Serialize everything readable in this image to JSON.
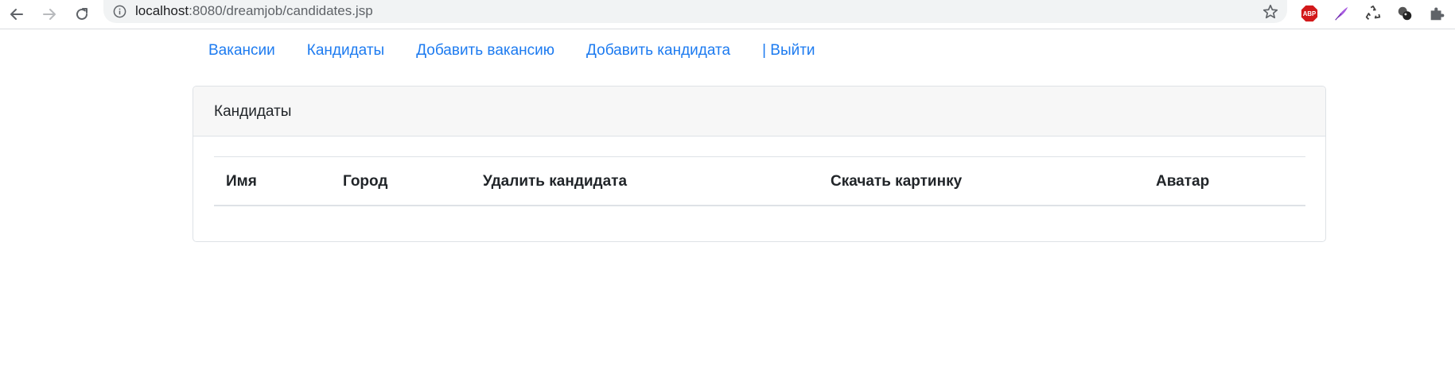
{
  "browser": {
    "url_host": "localhost",
    "url_rest": ":8080/dreamjob/candidates.jsp",
    "icons": {
      "back": "arrow-left-icon",
      "forward": "arrow-right-icon",
      "reload": "reload-icon",
      "info": "info-icon",
      "bookmark": "star-icon",
      "extensions": [
        "adblock-icon",
        "quill-icon",
        "recycle-icon",
        "balls-icon",
        "puzzle-icon"
      ]
    },
    "adblock_label": "ABP"
  },
  "nav": {
    "items": [
      {
        "label": "Вакансии"
      },
      {
        "label": "Кандидаты"
      },
      {
        "label": "Добавить вакансию"
      },
      {
        "label": "Добавить кандидата"
      },
      {
        "label": "| Выйти"
      }
    ]
  },
  "card": {
    "title": "Кандидаты",
    "table": {
      "columns": [
        "Имя",
        "Город",
        "Удалить кандидата",
        "Скачать картинку",
        "Аватар"
      ],
      "rows": []
    }
  },
  "colors": {
    "link": "#1d7bf0",
    "text": "#212529",
    "card_header_bg": "#f7f7f7",
    "border": "#dee2e6"
  }
}
